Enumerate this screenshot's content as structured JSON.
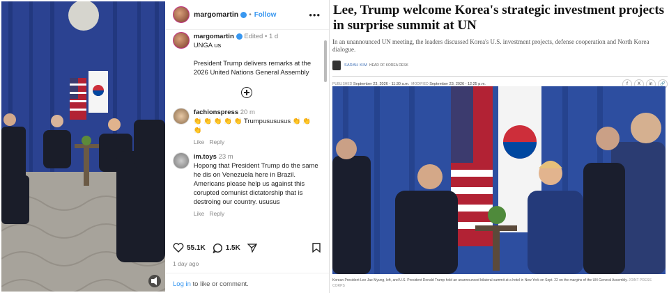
{
  "instagram": {
    "header": {
      "username": "margomartin",
      "follow_label": "Follow"
    },
    "post": {
      "username": "margomartin",
      "edited": "Edited",
      "age": "1 d",
      "caption_title": "UNGA us",
      "caption_body": "President Trump delivers remarks at the 2026 United Nations General Assembly"
    },
    "comments": [
      {
        "username": "fachionspress",
        "age": "20 m",
        "text": "👏 👏 👏 👏 👏 Trumpusususus 👏 👏 👏",
        "like": "Like",
        "reply": "Reply"
      },
      {
        "username": "im.toys",
        "age": "23 m",
        "text": "Hopong that President Trump do the same he dis on Venezuela here in Brazil. Americans please help us against this corupted comunist dictatorship that is destroing our country. ususus",
        "like": "Like",
        "reply": "Reply"
      }
    ],
    "actions": {
      "likes": "55.1K",
      "comments": "1.5K"
    },
    "time_ago": "1 day ago",
    "login": {
      "link": "Log in",
      "text": " to like or comment."
    }
  },
  "article": {
    "headline": "Lee, Trump welcome Korea's strategic investment projects in surprise summit at UN",
    "dek": "In an unannounced UN meeting, the leaders discussed Korea's U.S. investment projects, defense cooperation and North Korea dialogue.",
    "author": "SARAH KIM",
    "author_role": "HEAD OF KOREA DESK",
    "published_label": "PUBLISHED",
    "published": "September 23, 2026 - 11:30 a.m.",
    "modified_label": "MODIFIED",
    "modified": "September 23, 2026 - 12:25 p.m.",
    "share": [
      "f",
      "X",
      "in",
      "🔗"
    ],
    "caption": "Korean President Lee Jae Myung, left, and U.S. President Donald Trump hold an unannounced bilateral summit at a hotel in New York on Sept. 22 on the margins of the UN General Assembly.",
    "credit": "JOINT PRESS CORPS"
  }
}
